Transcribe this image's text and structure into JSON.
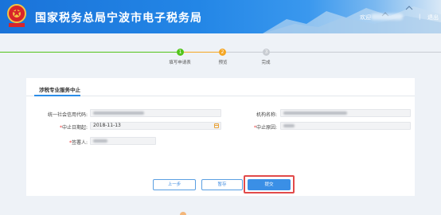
{
  "header": {
    "site_title": "国家税务总局宁波市电子税务局",
    "user_prefix": "欢迎",
    "separator": "|",
    "logout_label": "退出"
  },
  "steps": [
    {
      "number": "1",
      "label": "填写申请表",
      "state": "done"
    },
    {
      "number": "2",
      "label": "预览",
      "state": "current"
    },
    {
      "number": "3",
      "label": "完成",
      "state": "pending"
    }
  ],
  "colors": {
    "step_done": "#52c41a",
    "step_current": "#f5a623",
    "step_pending": "#c8ccd2",
    "accent": "#2c8de8",
    "highlight": "#e24a4a"
  },
  "form": {
    "title": "涉税专业服务中止",
    "fields": {
      "credit_code": {
        "label": "统一社会信用代码:",
        "required": false,
        "value": ""
      },
      "org_name": {
        "label": "机构名称:",
        "required": false,
        "value": ""
      },
      "stop_date": {
        "label": "中止日期起:",
        "required": true,
        "value": "2018-11-13"
      },
      "stop_reason": {
        "label": "中止原因:",
        "required": true,
        "value": ""
      },
      "signer": {
        "label": "签署人:",
        "required": true,
        "value": ""
      }
    }
  },
  "buttons": {
    "prev_label": "上一步",
    "save_label": "暂存",
    "submit_label": "提交"
  },
  "icons": {
    "emblem": "tax-emblem-icon",
    "calendar": "calendar-icon"
  }
}
